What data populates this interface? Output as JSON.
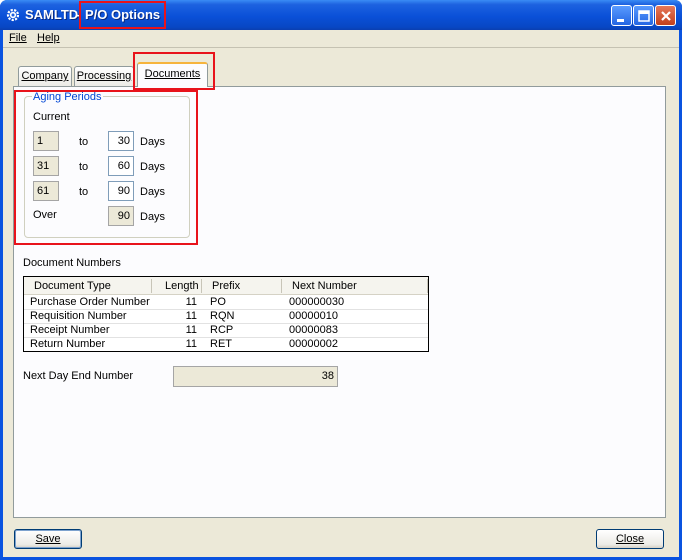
{
  "window": {
    "app_name": "SAMLTD",
    "separator": "-",
    "title": "P/O Options"
  },
  "menu": {
    "file": "File",
    "help": "Help"
  },
  "tabs": [
    {
      "label": "Company"
    },
    {
      "label": "Processing"
    },
    {
      "label": "Documents",
      "selected": true
    }
  ],
  "aging": {
    "group_title": "Aging Periods",
    "current_label": "Current",
    "to_label": "to",
    "days_label": "Days",
    "over_label": "Over",
    "rows": [
      {
        "from": "1",
        "to": "30"
      },
      {
        "from": "31",
        "to": "60"
      },
      {
        "from": "61",
        "to": "90"
      }
    ],
    "over_value": "90"
  },
  "document_numbers": {
    "section_label": "Document Numbers",
    "columns": [
      "Document Type",
      "Length",
      "Prefix",
      "Next Number"
    ],
    "rows": [
      {
        "type": "Purchase Order Number",
        "length": "11",
        "prefix": "PO",
        "next": "000000030"
      },
      {
        "type": "Requisition Number",
        "length": "11",
        "prefix": "RQN",
        "next": "00000010"
      },
      {
        "type": "Receipt Number",
        "length": "11",
        "prefix": "RCP",
        "next": "00000083"
      },
      {
        "type": "Return Number",
        "length": "11",
        "prefix": "RET",
        "next": "00000002"
      }
    ]
  },
  "next_day_end": {
    "label": "Next Day End Number",
    "value": "38"
  },
  "buttons": {
    "save": "Save",
    "close": "Close"
  },
  "colors": {
    "titlebar": "#0a50d8",
    "highlight": "#e8131b",
    "group_title": "#0046d5",
    "dialog_bg": "#ece9d8"
  }
}
